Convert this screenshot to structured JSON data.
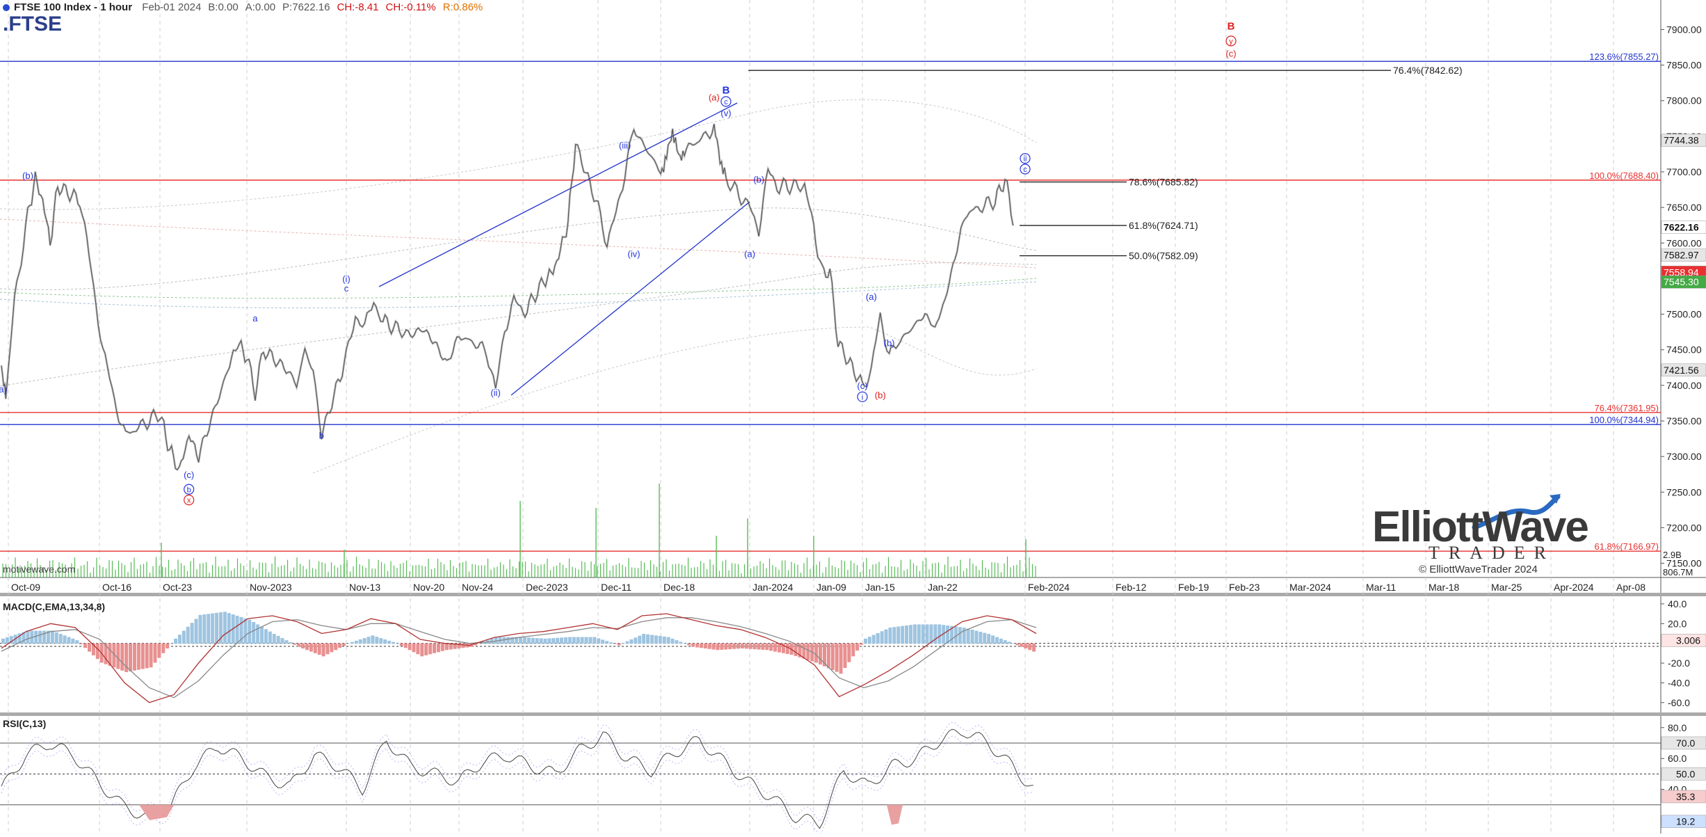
{
  "header": {
    "title": "FTSE 100 Index - 1 hour",
    "date": "Feb-01 2024",
    "bid": "B:0.00",
    "ask": "A:0.00",
    "price": "P:7622.16",
    "change": "CH:-8.41",
    "change_pct": "CH:-0.11%",
    "range": "R:0.86%",
    "symbol": ".FTSE",
    "accent_color": "#2b3f8a"
  },
  "watermark": "motivewave.com",
  "logo": {
    "name_line": "ElliottWave",
    "sub_line": "TRADER",
    "copyright": "© ElliottWaveTrader 2024"
  },
  "colors": {
    "price_bar": "#5a5a5a",
    "blue_wave": "#2233dd",
    "red_wave": "#e02020",
    "red_line": "#e83030",
    "blue_line": "#2233cc",
    "volume": "#55bb55",
    "macd_line": "#b03030",
    "signal_line": "#888888",
    "hist_pos": "#9ec4e0",
    "hist_neg": "#e89090"
  },
  "chart_data": [
    {
      "type": "line",
      "panel": "price",
      "title": "FTSE 100 Index - 1 hour",
      "x_ticks": [
        "Oct-09",
        "Oct-16",
        "Oct-23",
        "Nov-2023",
        "Nov-13",
        "Nov-20",
        "Nov-24",
        "Dec-2023",
        "Dec-11",
        "Dec-18",
        "Jan-2024",
        "Jan-09",
        "Jan-15",
        "Jan-22",
        "Feb-2024",
        "Feb-12",
        "Feb-19",
        "Feb-23",
        "Mar-2024",
        "Mar-11",
        "Mar-18",
        "Mar-25",
        "Apr-2024",
        "Apr-08"
      ],
      "ylim": [
        7130,
        7920
      ],
      "y_ticks": [
        7150,
        7200,
        7250,
        7300,
        7350,
        7400,
        7450,
        7500,
        7550,
        7600,
        7650,
        7700,
        7750,
        7800,
        7850,
        7900
      ],
      "price_path": {
        "x": [
          "Oct-03",
          "Oct-04",
          "Oct-06",
          "Oct-09",
          "Oct-10",
          "Oct-11",
          "Oct-12",
          "Oct-13",
          "Oct-16",
          "Oct-17",
          "Oct-18",
          "Oct-19",
          "Oct-20",
          "Oct-23",
          "Oct-24",
          "Oct-25",
          "Oct-26",
          "Oct-27",
          "Oct-30",
          "Oct-31",
          "Nov-01",
          "Nov-02",
          "Nov-03",
          "Nov-06",
          "Nov-07",
          "Nov-08",
          "Nov-09",
          "Nov-10",
          "Nov-13",
          "Nov-14",
          "Nov-15",
          "Nov-16",
          "Nov-17",
          "Nov-20",
          "Nov-21",
          "Nov-22",
          "Nov-23",
          "Nov-24",
          "Nov-27",
          "Nov-28",
          "Nov-29",
          "Nov-30",
          "Dec-01",
          "Dec-04",
          "Dec-05",
          "Dec-06",
          "Dec-07",
          "Dec-08",
          "Dec-11",
          "Dec-12",
          "Dec-13",
          "Dec-14",
          "Dec-15",
          "Dec-18",
          "Dec-19",
          "Dec-20",
          "Dec-21",
          "Dec-22",
          "Dec-27",
          "Dec-28",
          "Dec-29",
          "Jan-02",
          "Jan-03",
          "Jan-04",
          "Jan-05",
          "Jan-08",
          "Jan-09",
          "Jan-10",
          "Jan-11",
          "Jan-12",
          "Jan-15",
          "Jan-16",
          "Jan-17",
          "Jan-18",
          "Jan-19",
          "Jan-22",
          "Jan-23",
          "Jan-24",
          "Jan-25",
          "Jan-26",
          "Jan-29",
          "Jan-30",
          "Jan-31",
          "Feb-01"
        ],
        "values": [
          7430,
          7385,
          7520,
          7640,
          7690,
          7660,
          7600,
          7680,
          7660,
          7560,
          7450,
          7380,
          7330,
          7360,
          7310,
          7280,
          7330,
          7300,
          7420,
          7460,
          7440,
          7390,
          7450,
          7420,
          7400,
          7450,
          7420,
          7330,
          7440,
          7500,
          7480,
          7520,
          7490,
          7470,
          7480,
          7460,
          7430,
          7470,
          7450,
          7390,
          7480,
          7520,
          7500,
          7550,
          7560,
          7590,
          7630,
          7740,
          7650,
          7600,
          7640,
          7700,
          7760,
          7700,
          7720,
          7760,
          7720,
          7730,
          7760,
          7720,
          7690,
          7650,
          7620,
          7700,
          7680,
          7680,
          7620,
          7560,
          7560,
          7460,
          7400,
          7420,
          7500,
          7440,
          7460,
          7500,
          7480,
          7520,
          7580,
          7640,
          7660,
          7690,
          7620
        ]
      },
      "wave_labels": [
        {
          "x": "Oct-03",
          "y": 7390,
          "text": "(a)",
          "color": "blue"
        },
        {
          "x": "Oct-09",
          "y": 7690,
          "text": "(b)",
          "color": "blue"
        },
        {
          "x": "Oct-26",
          "y": 7270,
          "text": "(c)",
          "color": "blue"
        },
        {
          "x": "Oct-26",
          "y": 7250,
          "text": "b",
          "color": "blue",
          "circled": true
        },
        {
          "x": "Oct-26",
          "y": 7235,
          "text": "x",
          "color": "red",
          "circled": true
        },
        {
          "x": "Nov-02",
          "y": 7490,
          "text": "a",
          "color": "blue"
        },
        {
          "x": "Nov-10",
          "y": 7325,
          "text": "b",
          "color": "blue"
        },
        {
          "x": "Nov-13",
          "y": 7545,
          "text": "(i)",
          "color": "blue"
        },
        {
          "x": "Nov-13",
          "y": 7532,
          "text": "c",
          "color": "blue"
        },
        {
          "x": "Nov-28",
          "y": 7385,
          "text": "(ii)",
          "color": "blue"
        },
        {
          "x": "Dec-14",
          "y": 7733,
          "text": "(iii)",
          "color": "blue"
        },
        {
          "x": "Dec-15",
          "y": 7580,
          "text": "(iv)",
          "color": "blue"
        },
        {
          "x": "Dec-27",
          "y": 7800,
          "text": "(a)",
          "color": "red"
        },
        {
          "x": "Dec-29",
          "y": 7810,
          "text": "B",
          "color": "blue"
        },
        {
          "x": "Dec-29",
          "y": 7795,
          "text": "c",
          "color": "blue",
          "circled": true
        },
        {
          "x": "Dec-29",
          "y": 7778,
          "text": "(v)",
          "color": "blue"
        },
        {
          "x": "Jan-03",
          "y": 7685,
          "text": "(b)",
          "color": "blue"
        },
        {
          "x": "Jan-02",
          "y": 7580,
          "text": "(a)",
          "color": "blue"
        },
        {
          "x": "Jan-16",
          "y": 7520,
          "text": "(a)",
          "color": "blue"
        },
        {
          "x": "Jan-18",
          "y": 7455,
          "text": "(b)",
          "color": "blue"
        },
        {
          "x": "Jan-15",
          "y": 7395,
          "text": "(c)",
          "color": "blue"
        },
        {
          "x": "Jan-15",
          "y": 7380,
          "text": "i",
          "color": "blue",
          "circled": true
        },
        {
          "x": "Jan-17",
          "y": 7382,
          "text": "(b)",
          "color": "red"
        },
        {
          "x": "Feb-01",
          "y": 7715,
          "text": "ii",
          "color": "blue",
          "circled": true
        },
        {
          "x": "Feb-01",
          "y": 7700,
          "text": "c",
          "color": "blue",
          "circled": true
        },
        {
          "x": "Feb-26",
          "y": 7900,
          "text": "B",
          "color": "red"
        },
        {
          "x": "Feb-26",
          "y": 7880,
          "text": "y",
          "color": "red",
          "circled": true
        },
        {
          "x": "Feb-26",
          "y": 7862,
          "text": "(c)",
          "color": "red"
        }
      ],
      "fib_levels": [
        {
          "label": "123.6%",
          "value": 7855.27,
          "color": "blue"
        },
        {
          "label": "76.4%",
          "value": 7842.62,
          "color": "black"
        },
        {
          "label": "100.0%",
          "value": 7688.4,
          "color": "red"
        },
        {
          "label": "78.6%",
          "value": 7685.82,
          "color": "black"
        },
        {
          "label": "61.8%",
          "value": 7624.71,
          "color": "black"
        },
        {
          "label": "50.0%",
          "value": 7582.09,
          "color": "black"
        },
        {
          "label": "76.4%",
          "value": 7361.95,
          "color": "red"
        },
        {
          "label": "100.0%",
          "value": 7344.94,
          "color": "blue"
        },
        {
          "label": "61.8%",
          "value": 7166.97,
          "color": "red"
        }
      ],
      "price_badges": [
        {
          "value": "7744.38",
          "bg": "#e6e6e6",
          "fg": "#111"
        },
        {
          "value": "7622.16",
          "bg": "#ffffff",
          "fg": "#111",
          "bold": true
        },
        {
          "value": "7582.97",
          "bg": "#e6e6e6",
          "fg": "#111"
        },
        {
          "value": "7558.94",
          "bg": "#e83030",
          "fg": "#fff"
        },
        {
          "value": "7545.30",
          "bg": "#44aa44",
          "fg": "#fff"
        },
        {
          "value": "7421.56",
          "bg": "#e6e6e6",
          "fg": "#111"
        }
      ],
      "volume_axis": [
        "2.9B",
        "806.7M"
      ]
    },
    {
      "type": "line",
      "panel": "macd",
      "title": "MACD(C,EMA,13,34,8)",
      "ylim": [
        -70,
        47
      ],
      "y_ticks": [
        40,
        20,
        -20,
        -40,
        -60
      ],
      "current_value": "3.006",
      "series": [
        {
          "values": [
            -5,
            12,
            20,
            16,
            -8,
            -40,
            -60,
            -52,
            -20,
            8,
            25,
            28,
            22,
            10,
            14,
            25,
            20,
            4,
            0,
            -2,
            6,
            10,
            12,
            16,
            20,
            14,
            28,
            30,
            24,
            18,
            14,
            6,
            -5,
            -22,
            -54,
            -42,
            -28,
            -12,
            6,
            22,
            28,
            24,
            10
          ]
        },
        {
          "values": [
            -8,
            4,
            12,
            14,
            4,
            -22,
            -45,
            -55,
            -38,
            -12,
            10,
            22,
            24,
            18,
            14,
            20,
            20,
            12,
            4,
            0,
            2,
            6,
            9,
            12,
            16,
            15,
            22,
            26,
            26,
            22,
            17,
            10,
            2,
            -10,
            -35,
            -45,
            -38,
            -24,
            -6,
            12,
            22,
            24,
            16
          ]
        }
      ]
    },
    {
      "type": "line",
      "panel": "rsi",
      "title": "RSI(C,13)",
      "ylim": [
        15,
        88
      ],
      "y_ticks": [
        80,
        60,
        40,
        20
      ],
      "levels": [
        "70.0",
        "50.0",
        "35.3",
        "19.2"
      ],
      "series": [
        {
          "values": [
            40,
            62,
            70,
            62,
            45,
            30,
            22,
            28,
            55,
            68,
            60,
            48,
            42,
            62,
            55,
            40,
            72,
            55,
            50,
            45,
            58,
            62,
            55,
            50,
            65,
            75,
            60,
            52,
            64,
            72,
            58,
            45,
            35,
            22,
            18,
            52,
            42,
            55,
            60,
            72,
            78,
            70,
            55,
            38
          ]
        }
      ]
    }
  ]
}
